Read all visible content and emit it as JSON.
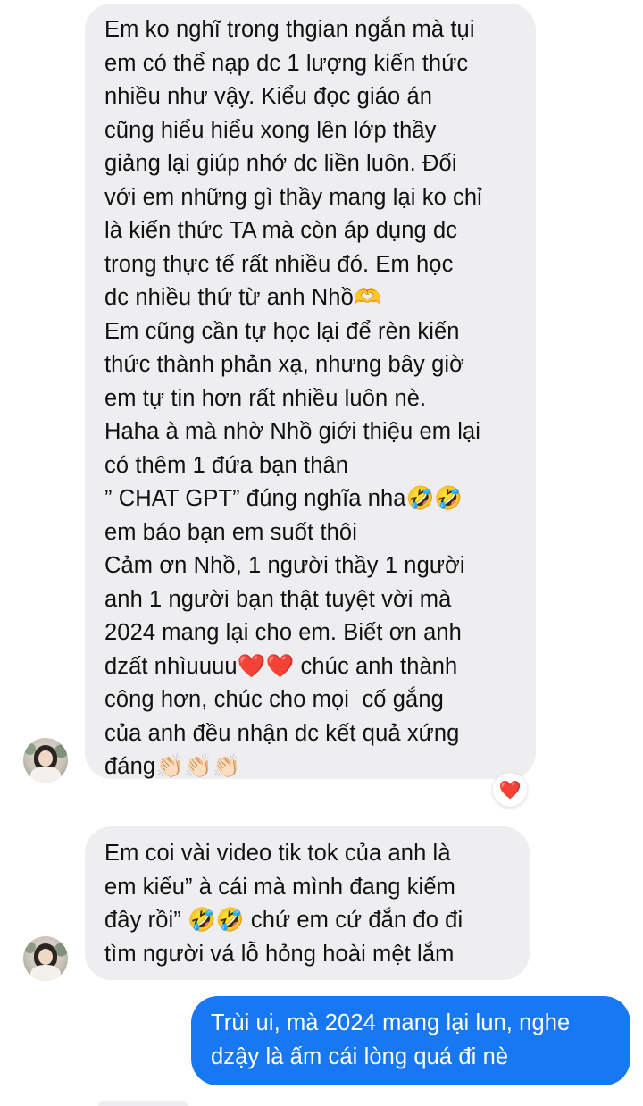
{
  "conversation": {
    "messages": [
      {
        "sender": "contact",
        "lines": [
          "Em ko nghĩ trong thgian ngắn mà tụi",
          "em có thể nạp dc 1 lượng kiến thức",
          "nhiều như vậy. Kiểu đọc giáo án",
          "cũng hiểu hiểu xong lên lớp thầy",
          "giảng lại giúp nhớ dc liền luôn. Đối",
          "với em những gì thầy mang lại ko chỉ",
          "là kiến thức TA mà còn áp dụng dc",
          "trong thực tế rất nhiều đó. Em học",
          "dc nhiều thứ từ anh Nhồ🫶",
          "Em cũng cần tự học lại để rèn kiến",
          "thức thành phản xạ, nhưng bây giờ",
          "em tự tin hơn rất nhiều luôn nè.",
          "Haha à mà nhờ Nhồ giới thiệu em lại",
          "có thêm 1 đứa bạn thân",
          "” CHAT GPT” đúng nghĩa nha🤣🤣",
          "em báo bạn em suốt thôi",
          "Cảm ơn Nhồ, 1 người thầy 1 người",
          "anh 1 người bạn thật tuyệt vời mà",
          "2024 mang lại cho em. Biết ơn anh",
          "dzất nhìuuuu❤️❤️ chúc anh thành",
          "công hơn, chúc cho mọi  cố gắng",
          "của anh đều nhận dc kết quả xứng",
          "đáng👏🏻👏🏻👏🏻"
        ],
        "reaction": "❤️"
      },
      {
        "sender": "contact",
        "lines": [
          "Em coi vài video tik tok của anh là",
          "em kiểu” à cái mà mình đang kiếm",
          "đây rồi” 🤣🤣 chứ em cứ đắn đo đi",
          "tìm người vá lỗ hỏng hoài mệt lắm"
        ]
      },
      {
        "sender": "me",
        "lines": [
          "Trùi ui, mà 2024 mang lại lun, nghe",
          "dzậy là ấm cái lòng quá đi nè"
        ]
      }
    ]
  },
  "colors": {
    "incoming_bubble": "#eeeef0",
    "outgoing_bubble": "#1877f2",
    "incoming_text": "#111111",
    "outgoing_text": "#ffffff",
    "reaction_heart": "#e0245e"
  }
}
